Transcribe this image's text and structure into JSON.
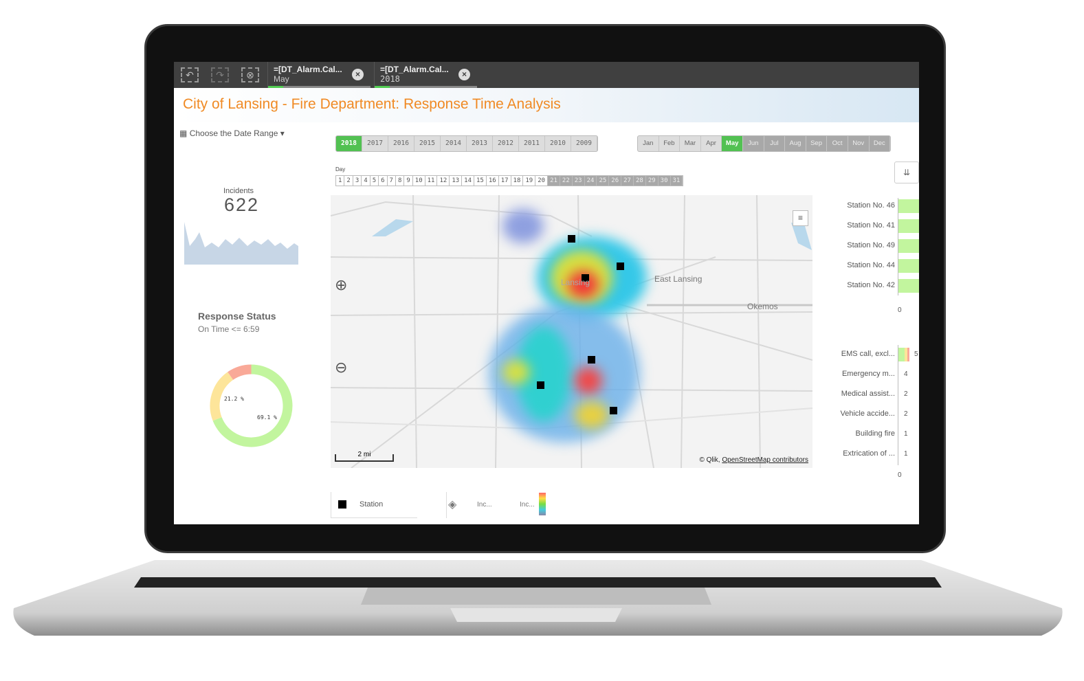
{
  "toolbar": {
    "icons": [
      "step-back-icon",
      "step-forward-icon",
      "clear-selections-icon"
    ],
    "selections": [
      {
        "field": "=[DT_Alarm.Cal...",
        "value": "May"
      },
      {
        "field": "=[DT_Alarm.Cal...",
        "value": "2018"
      }
    ]
  },
  "header": {
    "title": "City of Lansing - Fire Department: Response Time Analysis"
  },
  "date_range": {
    "label": "Choose the Date Range"
  },
  "years": {
    "items": [
      "2018",
      "2017",
      "2016",
      "2015",
      "2014",
      "2013",
      "2012",
      "2011",
      "2010",
      "2009"
    ],
    "selected": "2018"
  },
  "months": {
    "items": [
      "Jan",
      "Feb",
      "Mar",
      "Apr",
      "May",
      "Jun",
      "Jul",
      "Aug",
      "Sep",
      "Oct",
      "Nov",
      "Dec"
    ],
    "selected": "May",
    "excluded_from": "Jun"
  },
  "days": {
    "label": "Day",
    "items": [
      "1",
      "2",
      "3",
      "4",
      "5",
      "6",
      "7",
      "8",
      "9",
      "10",
      "11",
      "12",
      "13",
      "14",
      "15",
      "16",
      "17",
      "18",
      "19",
      "20",
      "21",
      "22",
      "23",
      "24",
      "25",
      "26",
      "27",
      "28",
      "29",
      "30",
      "31"
    ],
    "excluded_from": 21
  },
  "incidents": {
    "label": "Incidents",
    "value": "622"
  },
  "response_status": {
    "title": "Response Status",
    "subtitle": "On Time <= 6:59",
    "chart_data": {
      "type": "pie",
      "slices": [
        {
          "label": "69.1 %",
          "value": 69.1,
          "color": "#c2f59e"
        },
        {
          "label": "21.2 %",
          "value": 21.2,
          "color": "#fde59a"
        },
        {
          "label": "",
          "value": 9.7,
          "color": "#f9a998"
        }
      ]
    }
  },
  "map": {
    "places": [
      "Lansing",
      "East Lansing",
      "Okemos"
    ],
    "scale": "2 mi",
    "attribution_prefix": "© Qlik, ",
    "attribution_link": "OpenStreetMap contributors",
    "colors": {
      "station": "#000000"
    }
  },
  "legend": {
    "station": "Station",
    "inc1": "Inc...",
    "inc2": "Inc..."
  },
  "stations_chart": {
    "items": [
      "Station No. 46",
      "Station No. 41",
      "Station No. 49",
      "Station No. 44",
      "Station No. 42"
    ],
    "axis_zero": "0",
    "bar_color": "#c2f59e"
  },
  "types_chart": {
    "items": [
      {
        "label": "EMS call, excl...",
        "value": "5"
      },
      {
        "label": "Emergency m...",
        "value": "4"
      },
      {
        "label": "Medical assist...",
        "value": "2"
      },
      {
        "label": "Vehicle accide...",
        "value": "2"
      },
      {
        "label": "Building fire",
        "value": "1"
      },
      {
        "label": "Extrication of ...",
        "value": "1"
      }
    ],
    "axis_zero": "0"
  }
}
